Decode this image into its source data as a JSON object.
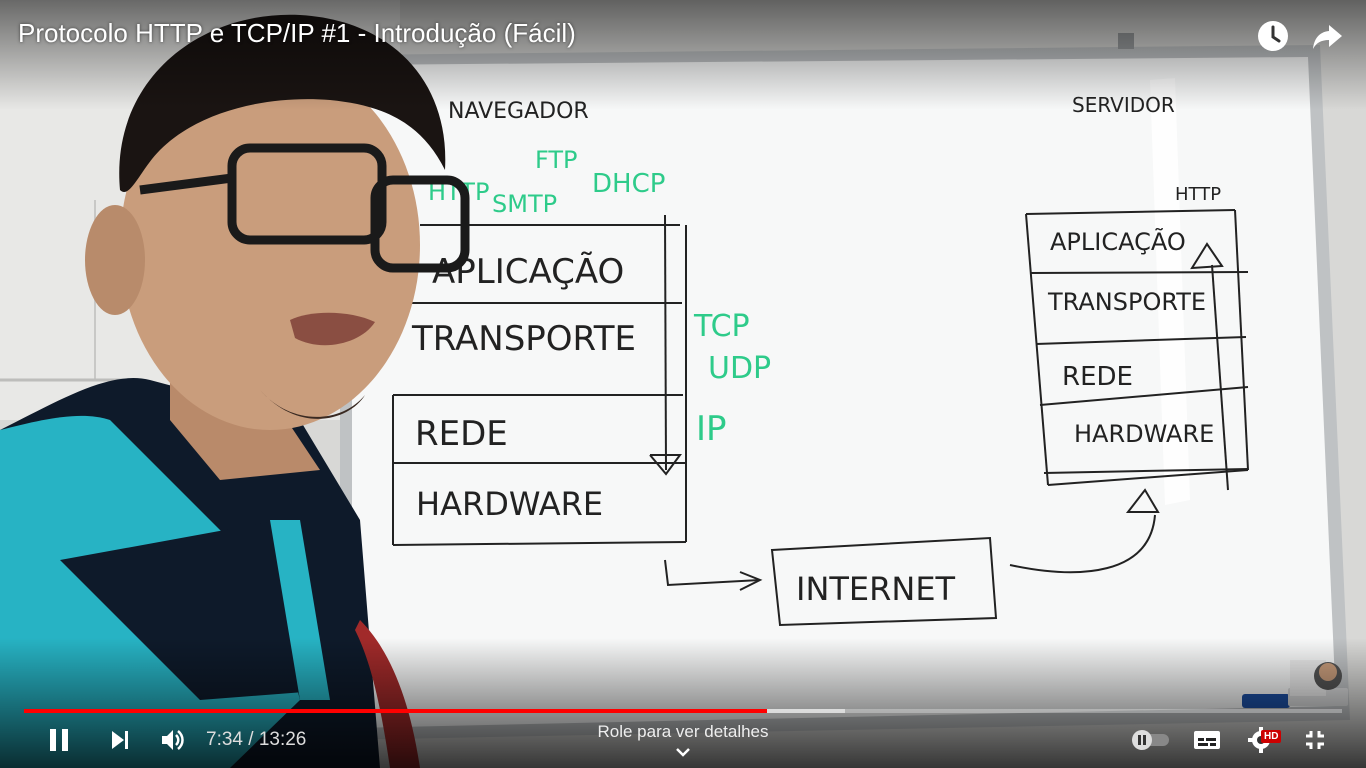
{
  "video": {
    "title": "Protocolo HTTP e TCP/IP #1 - Introdução (Fácil)",
    "whiteboard": {
      "left_header": "NAVEGADOR",
      "right_header": "SERVIDOR",
      "right_protocol": "HTTP",
      "app_protocols": [
        "HTTP",
        "FTP",
        "SMTP",
        "DHCP"
      ],
      "left_layers": [
        "APLICAÇÃO",
        "TRANSPORTE",
        "REDE",
        "HARDWARE"
      ],
      "transport_protocols": [
        "TCP",
        "UDP"
      ],
      "network_protocol": "IP",
      "right_layers": [
        "APLICAÇÃO",
        "TRANSPORTE",
        "REDE",
        "HARDWARE"
      ],
      "internet_label": "INTERNET"
    }
  },
  "player": {
    "current_time": "7:34",
    "duration": "13:26",
    "time_display": "7:34 / 13:26",
    "progress_fraction": 0.564,
    "buffered_fraction": 0.623,
    "scroll_hint": "Role para ver detalhes",
    "quality_badge": "HD",
    "colors": {
      "progress": "#ff0000",
      "badge": "#cc0000"
    },
    "icons": [
      "clock-icon",
      "share-icon",
      "pause-icon",
      "next-icon",
      "volume-icon",
      "autoplay-toggle",
      "subtitles-icon",
      "settings-icon",
      "exit-fullscreen-icon",
      "chevron-down-icon"
    ]
  }
}
